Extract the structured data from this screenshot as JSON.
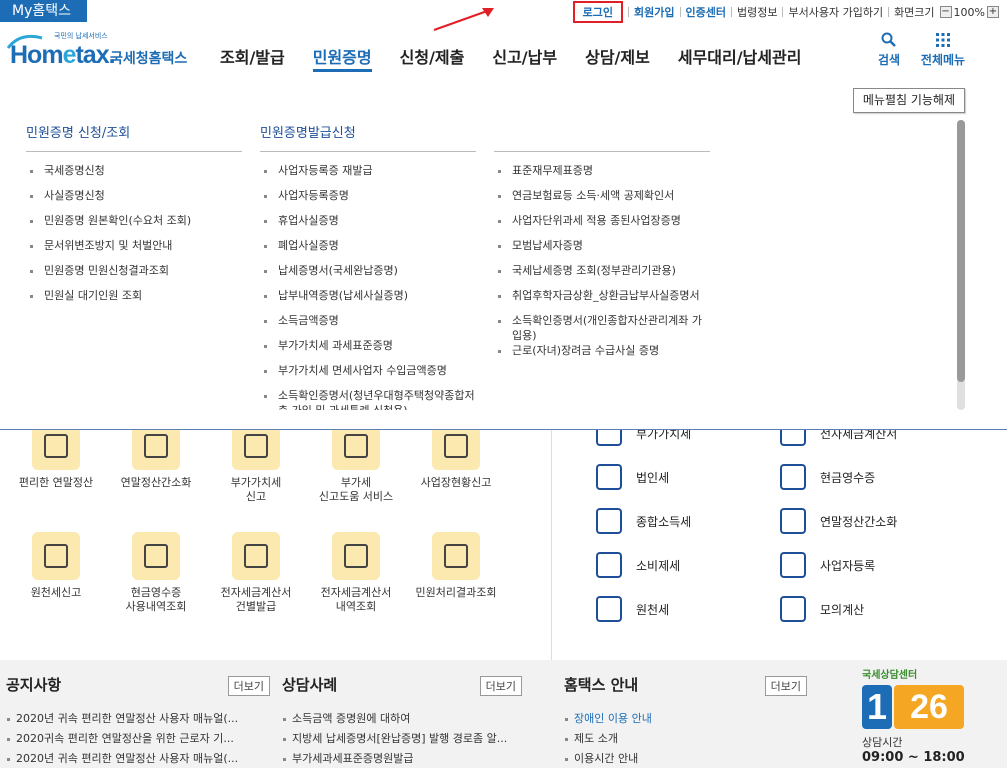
{
  "topbar": {
    "my_hometax": "My홈택스",
    "login": "로그인",
    "signup": "회원가입",
    "cert_center": "인증센터",
    "legal_info": "법령정보",
    "dept_user_join": "부서사용자 가입하기",
    "screen_size": "화면크기",
    "zoom_level": "100%",
    "zoom_minus": "−",
    "zoom_plus": "+"
  },
  "logo": {
    "slogan": "국민의 납세서비스",
    "brand_en_1": "Hom",
    "brand_en_2": "e",
    "brand_en_3": "tax.",
    "brand_kr": "국세청홈택스"
  },
  "gnb": [
    "조회/발급",
    "민원증명",
    "신청/제출",
    "신고/납부",
    "상담/제보",
    "세무대리/납세관리"
  ],
  "header_icons": {
    "search": "검색",
    "all_menu": "전체메뉴"
  },
  "mega_menu": {
    "disable_button": "메뉴펼침 기능해제",
    "columns": [
      {
        "title": "민원증명 신청/조회",
        "items": [
          "국세증명신청",
          "사실증명신청",
          "민원증명 원본확인(수요처 조회)",
          "문서위변조방지 및 처벌안내",
          "민원증명 민원신청결과조회",
          "민원실 대기인원 조회"
        ]
      },
      {
        "title": "민원증명발급신청",
        "items": [
          "사업자등록증 재발급",
          "사업자등록증명",
          "휴업사실증명",
          "폐업사실증명",
          "납세증명서(국세완납증명)",
          "납부내역증명(납세사실증명)",
          "소득금액증명",
          "부가가치세 과세표준증명",
          "부가가치세 면세사업자 수입금액증명",
          "소득확인증명서(청년우대형주택청약종합저축 가입 및 과세특례 신청용)"
        ]
      },
      {
        "title": "",
        "items": [
          "표준재무제표증명",
          "연금보험료등 소득·세액 공제확인서",
          "사업자단위과세 적용 종된사업장증명",
          "모범납세자증명",
          "국세납세증명 조회(정부관리기관용)",
          "취업후학자금상환_상환금납부사실증명서",
          "소득확인증명서(개인종합자산관리계좌 가입용)",
          "근로(자녀)장려금 수급사실 증명"
        ]
      }
    ]
  },
  "tiles": [
    [
      "편리한 연말정산",
      ""
    ],
    [
      "연말정산간소화",
      ""
    ],
    [
      "부가가치세",
      "신고"
    ],
    [
      "부가세",
      "신고도움 서비스"
    ],
    [
      "사업장현황신고",
      ""
    ],
    [
      "원천세신고",
      ""
    ],
    [
      "현금영수증",
      "사용내역조회"
    ],
    [
      "전자세금계산서",
      "건별발급"
    ],
    [
      "전자세금계산서",
      "내역조회"
    ],
    [
      "민원처리결과조회",
      ""
    ]
  ],
  "services_left": [
    "부가가치세",
    "법인세",
    "종합소득세",
    "소비제세",
    "원천세"
  ],
  "services_right": [
    "전자세금계산서",
    "현금영수증",
    "연말정산간소화",
    "사업자등록",
    "모의계산"
  ],
  "bottom": {
    "more": "더보기",
    "notice": {
      "title": "공지사항",
      "items": [
        "2020년 귀속 편리한 연말정산 사용자 매뉴얼(...",
        "2020귀속 편리한 연말정산을 위한 근로자 기...",
        "2020년 귀속 편리한 연말정산 사용자 매뉴얼(..."
      ]
    },
    "consult": {
      "title": "상담사례",
      "items": [
        "소득금액 증명원에 대하여",
        "지방세 납세증명서[완납증명] 발행 경로좀 알...",
        "부가세과세표준증명원발급"
      ]
    },
    "guide": {
      "title": "홈택스 안내",
      "items": [
        "장애인 이용 안내",
        "제도 소개",
        "이용시간 안내"
      ]
    },
    "center": {
      "label": "국세상담센터",
      "number_1": "1",
      "number_2": "26",
      "hours_label": "상담시간",
      "hours": "09:00 ~ 18:00"
    }
  }
}
